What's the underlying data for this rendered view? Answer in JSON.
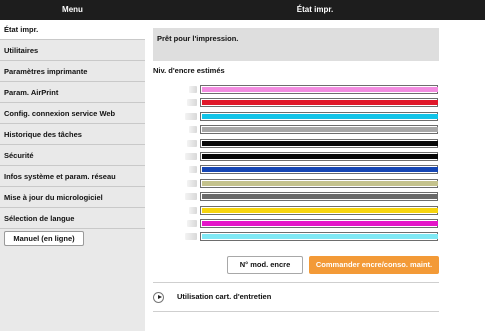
{
  "header": {
    "menu_title": "Menu",
    "page_title": "État impr."
  },
  "sidebar": {
    "items": [
      {
        "label": "État impr.",
        "active": true
      },
      {
        "label": "Utilitaires"
      },
      {
        "label": "Paramètres imprimante"
      },
      {
        "label": "Param. AirPrint"
      },
      {
        "label": "Config. connexion service Web"
      },
      {
        "label": "Historique des tâches"
      },
      {
        "label": "Sécurité"
      },
      {
        "label": "Infos système et param. réseau"
      },
      {
        "label": "Mise à jour du micrologiciel"
      },
      {
        "label": "Sélection de langue"
      }
    ],
    "manual_button": "Manuel (en ligne)"
  },
  "main": {
    "status": "Prêt pour l'impression.",
    "ink_heading": "Niv. d'encre estimés",
    "inks": [
      {
        "color": "#f28ce0",
        "icon": "ink-cartridge-icon",
        "level": 1.0
      },
      {
        "color": "#e0182a",
        "icon": "ink-cartridge-icon",
        "level": 1.0
      },
      {
        "color": "#12c4e8",
        "icon": "ink-cartridge-icon",
        "level": 1.0
      },
      {
        "color": "#a8a8a8",
        "icon": "ink-cartridge-icon",
        "level": 1.0
      },
      {
        "color": "#080808",
        "icon": "ink-cartridge-icon",
        "level": 1.0
      },
      {
        "color": "#060606",
        "icon": "ink-cartridge-icon",
        "level": 1.0
      },
      {
        "color": "#1646b4",
        "icon": "ink-cartridge-icon",
        "level": 1.0
      },
      {
        "color": "#c4c28c",
        "icon": "ink-cartridge-icon",
        "level": 1.0
      },
      {
        "color": "#6a6a6a",
        "icon": "ink-cartridge-icon",
        "level": 1.0
      },
      {
        "color": "#f6d40e",
        "icon": "ink-cartridge-icon",
        "level": 1.0
      },
      {
        "color": "#e414c8",
        "icon": "ink-cartridge-icon",
        "level": 1.0
      },
      {
        "color": "#7ee8f4",
        "icon": "ink-cartridge-icon",
        "level": 1.0
      }
    ],
    "model_button": "N° mod. encre",
    "order_button": "Commander encre/conso. maint.",
    "maintenance_label": "Utilisation cart. d'entretien",
    "accent_color": "#f39a37"
  }
}
